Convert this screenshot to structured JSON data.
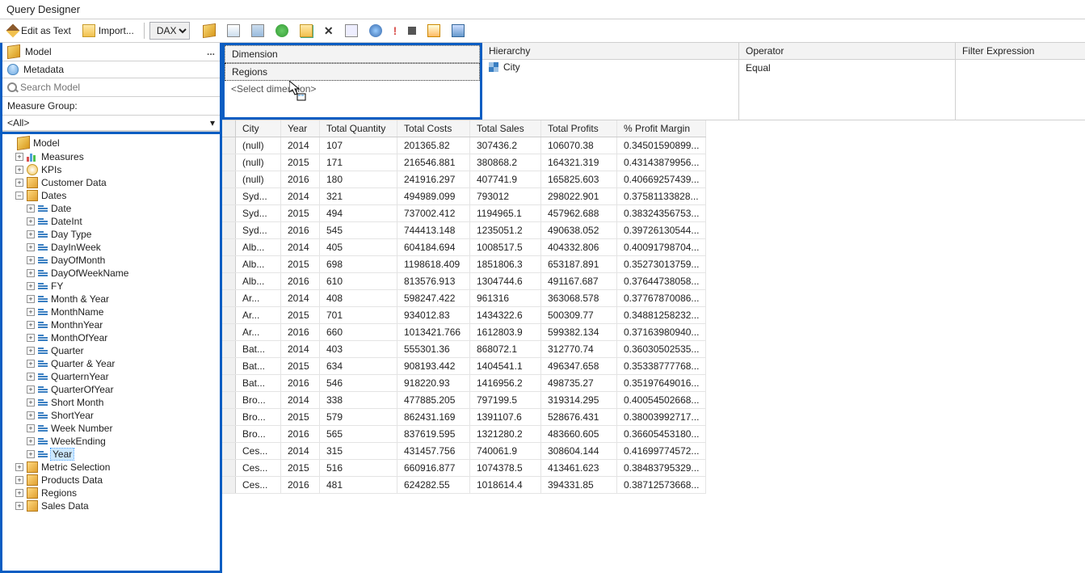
{
  "window_title": "Query Designer",
  "toolbar": {
    "edit_as_text": "Edit as Text",
    "import": "Import...",
    "mode": "DAX"
  },
  "left": {
    "model_label": "Model",
    "metadata_label": "Metadata",
    "search_placeholder": "Search Model",
    "measure_group_label": "Measure Group:",
    "measure_group_value": "<All>",
    "root": "Model",
    "measures": "Measures",
    "kpis": "KPIs",
    "customer": "Customer Data",
    "dates": "Dates",
    "date_children": [
      "Date",
      "DateInt",
      "Day Type",
      "DayInWeek",
      "DayOfMonth",
      "DayOfWeekName",
      "FY",
      "Month & Year",
      "MonthName",
      "MonthnYear",
      "MonthOfYear",
      "Quarter",
      "Quarter & Year",
      "QuarternYear",
      "QuarterOfYear",
      "Short Month",
      "ShortYear",
      "Week Number",
      "WeekEnding",
      "Year"
    ],
    "metric": "Metric Selection",
    "products": "Products Data",
    "regions": "Regions",
    "sales": "Sales Data"
  },
  "filter": {
    "dimension_header": "Dimension",
    "dimension_value": "Regions",
    "select_dimension": "<Select dimension>",
    "hierarchy_header": "Hierarchy",
    "hierarchy_value": "City",
    "operator_header": "Operator",
    "operator_value": "Equal",
    "filter_expr_header": "Filter Expression"
  },
  "grid": {
    "columns": [
      "City",
      "Year",
      "Total Quantity",
      "Total Costs",
      "Total Sales",
      "Total Profits",
      "% Profit Margin"
    ],
    "rows": [
      [
        "(null)",
        "2014",
        "107",
        "201365.82",
        "307436.2",
        "106070.38",
        "0.34501590899..."
      ],
      [
        "(null)",
        "2015",
        "171",
        "216546.881",
        "380868.2",
        "164321.319",
        "0.43143879956..."
      ],
      [
        "(null)",
        "2016",
        "180",
        "241916.297",
        "407741.9",
        "165825.603",
        "0.40669257439..."
      ],
      [
        "Syd...",
        "2014",
        "321",
        "494989.099",
        "793012",
        "298022.901",
        "0.37581133828..."
      ],
      [
        "Syd...",
        "2015",
        "494",
        "737002.412",
        "1194965.1",
        "457962.688",
        "0.38324356753..."
      ],
      [
        "Syd...",
        "2016",
        "545",
        "744413.148",
        "1235051.2",
        "490638.052",
        "0.39726130544..."
      ],
      [
        "Alb...",
        "2014",
        "405",
        "604184.694",
        "1008517.5",
        "404332.806",
        "0.40091798704..."
      ],
      [
        "Alb...",
        "2015",
        "698",
        "1198618.409",
        "1851806.3",
        "653187.891",
        "0.35273013759..."
      ],
      [
        "Alb...",
        "2016",
        "610",
        "813576.913",
        "1304744.6",
        "491167.687",
        "0.37644738058..."
      ],
      [
        "Ar...",
        "2014",
        "408",
        "598247.422",
        "961316",
        "363068.578",
        "0.37767870086..."
      ],
      [
        "Ar...",
        "2015",
        "701",
        "934012.83",
        "1434322.6",
        "500309.77",
        "0.34881258232..."
      ],
      [
        "Ar...",
        "2016",
        "660",
        "1013421.766",
        "1612803.9",
        "599382.134",
        "0.37163980940..."
      ],
      [
        "Bat...",
        "2014",
        "403",
        "555301.36",
        "868072.1",
        "312770.74",
        "0.36030502535..."
      ],
      [
        "Bat...",
        "2015",
        "634",
        "908193.442",
        "1404541.1",
        "496347.658",
        "0.35338777768..."
      ],
      [
        "Bat...",
        "2016",
        "546",
        "918220.93",
        "1416956.2",
        "498735.27",
        "0.35197649016..."
      ],
      [
        "Bro...",
        "2014",
        "338",
        "477885.205",
        "797199.5",
        "319314.295",
        "0.40054502668..."
      ],
      [
        "Bro...",
        "2015",
        "579",
        "862431.169",
        "1391107.6",
        "528676.431",
        "0.38003992717..."
      ],
      [
        "Bro...",
        "2016",
        "565",
        "837619.595",
        "1321280.2",
        "483660.605",
        "0.36605453180..."
      ],
      [
        "Ces...",
        "2014",
        "315",
        "431457.756",
        "740061.9",
        "308604.144",
        "0.41699774572..."
      ],
      [
        "Ces...",
        "2015",
        "516",
        "660916.877",
        "1074378.5",
        "413461.623",
        "0.38483795329..."
      ],
      [
        "Ces...",
        "2016",
        "481",
        "624282.55",
        "1018614.4",
        "394331.85",
        "0.38712573668..."
      ]
    ]
  }
}
